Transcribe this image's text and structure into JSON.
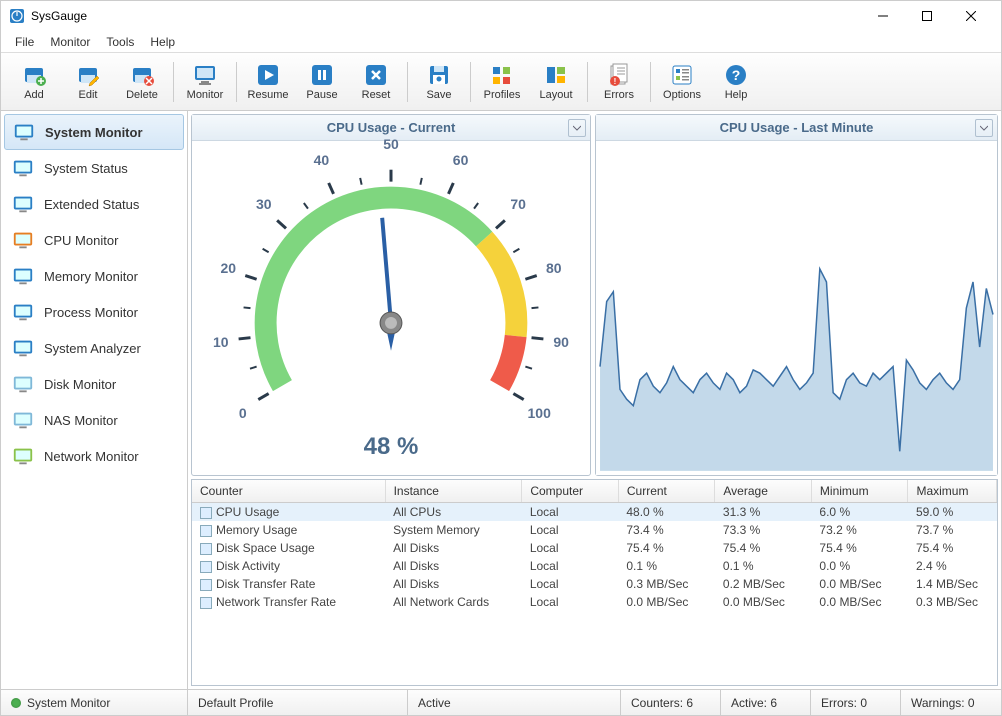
{
  "app": {
    "title": "SysGauge"
  },
  "menus": [
    "File",
    "Monitor",
    "Tools",
    "Help"
  ],
  "toolbar": [
    {
      "label": "Add",
      "icon": "add"
    },
    {
      "label": "Edit",
      "icon": "edit"
    },
    {
      "label": "Delete",
      "icon": "delete"
    },
    "|",
    {
      "label": "Monitor",
      "icon": "monitor"
    },
    "|",
    {
      "label": "Resume",
      "icon": "play"
    },
    {
      "label": "Pause",
      "icon": "pause"
    },
    {
      "label": "Reset",
      "icon": "reset"
    },
    "|",
    {
      "label": "Save",
      "icon": "save"
    },
    "|",
    {
      "label": "Profiles",
      "icon": "profiles"
    },
    {
      "label": "Layout",
      "icon": "layout"
    },
    "|",
    {
      "label": "Errors",
      "icon": "errors"
    },
    "|",
    {
      "label": "Options",
      "icon": "options"
    },
    {
      "label": "Help",
      "icon": "help"
    }
  ],
  "sidebar": {
    "items": [
      {
        "label": "System Monitor",
        "active": true
      },
      {
        "label": "System Status"
      },
      {
        "label": "Extended Status"
      },
      {
        "label": "CPU Monitor"
      },
      {
        "label": "Memory Monitor"
      },
      {
        "label": "Process Monitor"
      },
      {
        "label": "System Analyzer"
      },
      {
        "label": "Disk Monitor"
      },
      {
        "label": "NAS Monitor"
      },
      {
        "label": "Network Monitor"
      }
    ]
  },
  "gauge": {
    "title": "CPU Usage - Current",
    "value_text": "48 %",
    "value": 48,
    "ticks": [
      "0",
      "10",
      "20",
      "30",
      "40",
      "50",
      "60",
      "70",
      "80",
      "90",
      "100"
    ]
  },
  "chart_panel": {
    "title": "CPU Usage - Last Minute"
  },
  "chart_data": {
    "type": "area",
    "title": "CPU Usage - Last Minute",
    "xlabel": "",
    "ylabel": "",
    "ylim": [
      0,
      100
    ],
    "x": [
      0,
      1,
      2,
      3,
      4,
      5,
      6,
      7,
      8,
      9,
      10,
      11,
      12,
      13,
      14,
      15,
      16,
      17,
      18,
      19,
      20,
      21,
      22,
      23,
      24,
      25,
      26,
      27,
      28,
      29,
      30,
      31,
      32,
      33,
      34,
      35,
      36,
      37,
      38,
      39,
      40,
      41,
      42,
      43,
      44,
      45,
      46,
      47,
      48,
      49,
      50,
      51,
      52,
      53,
      54,
      55,
      56,
      57,
      58,
      59
    ],
    "values": [
      32,
      52,
      55,
      25,
      22,
      20,
      28,
      30,
      26,
      24,
      27,
      32,
      28,
      26,
      24,
      28,
      30,
      27,
      25,
      30,
      28,
      24,
      26,
      31,
      30,
      28,
      26,
      29,
      32,
      28,
      25,
      27,
      30,
      62,
      58,
      24,
      22,
      28,
      30,
      27,
      26,
      30,
      28,
      30,
      32,
      6,
      34,
      31,
      27,
      25,
      28,
      30,
      27,
      25,
      28,
      50,
      58,
      38,
      56,
      48
    ]
  },
  "table": {
    "columns": [
      "Counter",
      "Instance",
      "Computer",
      "Current",
      "Average",
      "Minimum",
      "Maximum"
    ],
    "rows": [
      [
        "CPU Usage",
        "All CPUs",
        "Local",
        "48.0 %",
        "31.3 %",
        "6.0 %",
        "59.0 %"
      ],
      [
        "Memory Usage",
        "System Memory",
        "Local",
        "73.4 %",
        "73.3 %",
        "73.2 %",
        "73.7 %"
      ],
      [
        "Disk Space Usage",
        "All Disks",
        "Local",
        "75.4 %",
        "75.4 %",
        "75.4 %",
        "75.4 %"
      ],
      [
        "Disk Activity",
        "All Disks",
        "Local",
        "0.1 %",
        "0.1 %",
        "0.0 %",
        "2.4 %"
      ],
      [
        "Disk Transfer Rate",
        "All Disks",
        "Local",
        "0.3 MB/Sec",
        "0.2 MB/Sec",
        "0.0 MB/Sec",
        "1.4 MB/Sec"
      ],
      [
        "Network Transfer Rate",
        "All Network Cards",
        "Local",
        "0.0 MB/Sec",
        "0.0 MB/Sec",
        "0.0 MB/Sec",
        "0.3 MB/Sec"
      ]
    ],
    "selected": 0
  },
  "status": {
    "left": "System Monitor",
    "profile": "Default Profile",
    "state": "Active",
    "counters": "Counters: 6",
    "active": "Active: 6",
    "errors": "Errors: 0",
    "warnings": "Warnings: 0"
  }
}
